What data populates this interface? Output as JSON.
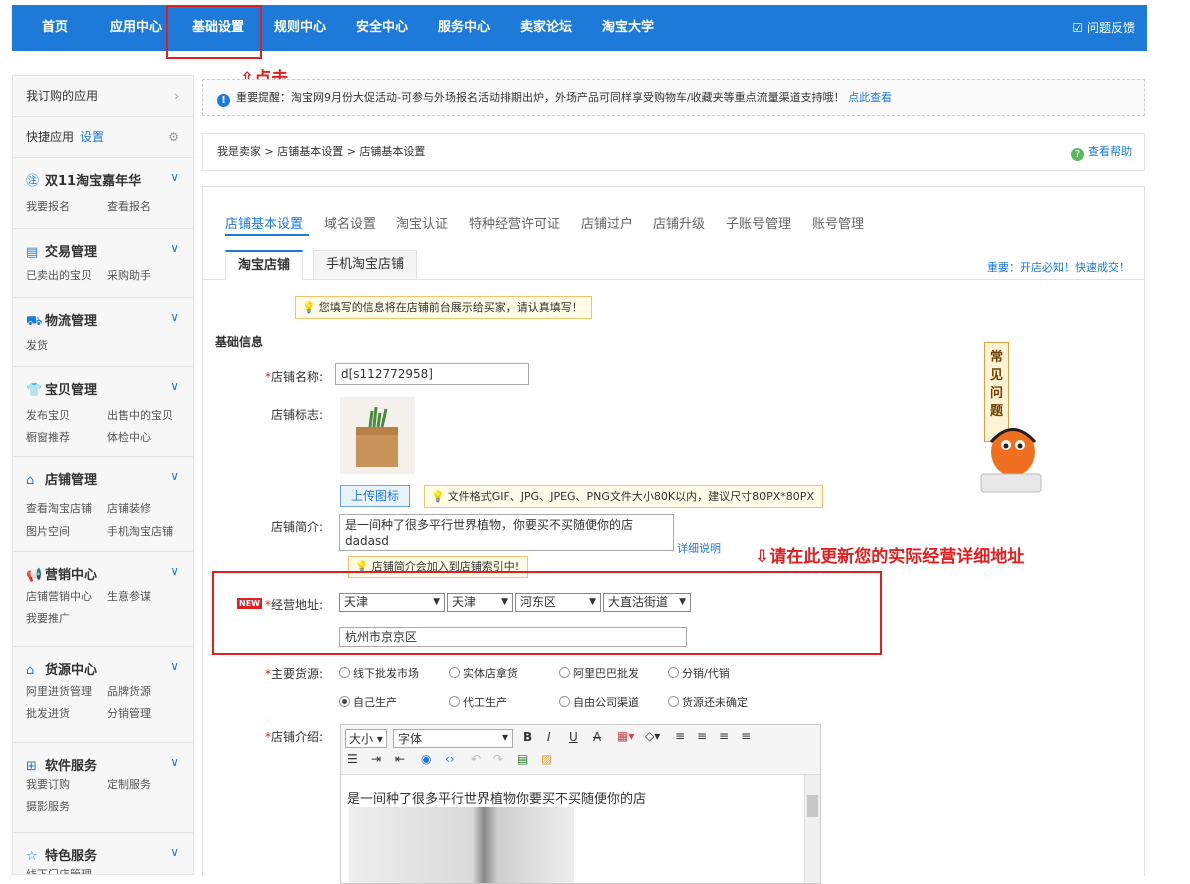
{
  "topnav": {
    "items": [
      "首页",
      "应用中心",
      "基础设置",
      "规则中心",
      "安全中心",
      "服务中心",
      "卖家论坛",
      "淘宝大学"
    ],
    "feedback": "问题反馈"
  },
  "annotations": {
    "click": "点击",
    "update_address": "请在此更新您的实际经营详细地址"
  },
  "sidebar": {
    "subscribed": "我订购的应用",
    "quick_apps": "快捷应用",
    "quick_settings": "设置",
    "sections": [
      {
        "title": "双11淘宝嘉年华",
        "icon": "double11-icon",
        "links": [
          "我要报名",
          "查看报名"
        ]
      },
      {
        "title": "交易管理",
        "icon": "document-icon",
        "links": [
          "已卖出的宝贝",
          "采购助手"
        ]
      },
      {
        "title": "物流管理",
        "icon": "truck-icon",
        "links": [
          "发货"
        ]
      },
      {
        "title": "宝贝管理",
        "icon": "shirt-icon",
        "links": [
          "发布宝贝",
          "出售中的宝贝",
          "橱窗推荐",
          "体检中心"
        ]
      },
      {
        "title": "店铺管理",
        "icon": "shop-icon",
        "links": [
          "查看淘宝店铺",
          "店铺装修",
          "图片空间",
          "手机淘宝店铺"
        ]
      },
      {
        "title": "营销中心",
        "icon": "megaphone-icon",
        "links": [
          "店铺营销中心",
          "生意参谋",
          "我要推广"
        ]
      },
      {
        "title": "货源中心",
        "icon": "house-icon",
        "links": [
          "阿里进货管理",
          "品牌货源",
          "批发进货",
          "分销管理"
        ]
      },
      {
        "title": "软件服务",
        "icon": "grid-icon",
        "links": [
          "我要订购",
          "定制服务",
          "摄影服务"
        ]
      },
      {
        "title": "特色服务",
        "icon": "star-icon",
        "links": [
          "线下门店管理"
        ]
      }
    ]
  },
  "notice": {
    "text": "重要提醒：淘宝网9月份大促活动-可参与外场报名活动排期出炉，外场产品可同样享受购物车/收藏夹等重点流量渠道支持哦！",
    "link": "点此查看"
  },
  "breadcrumb": {
    "text": "我是卖家 > 店铺基本设置 > 店铺基本设置",
    "help": "查看帮助"
  },
  "tabs": [
    "店铺基本设置",
    "域名设置",
    "淘宝认证",
    "特种经营许可证",
    "店铺过户",
    "店铺升级",
    "子账号管理",
    "账号管理"
  ],
  "subtabs": [
    "淘宝店铺",
    "手机淘宝店铺"
  ],
  "subtab_right": "重要：开店必知！快速成交！",
  "form": {
    "tip_info": "您填写的信息将在店铺前台展示给买家，请认真填写！",
    "section_title": "基础信息",
    "shop_name_label": "店铺名称:",
    "shop_name_value": "d[s112772958]",
    "logo_label": "店铺标志:",
    "upload_button": "上传图标",
    "upload_tip": "文件格式GIF、JPG、JPEG、PNG文件大小80K以内，建议尺寸80PX*80PX",
    "intro_label": "店铺简介:",
    "intro_value": "是一间种了很多平行世界植物，你要买不买随便你的店 dadasd",
    "intro_detail_link": "详细说明",
    "intro_tip": "店铺简介会加入到店铺索引中!",
    "new_badge": "NEW",
    "address_label": "经营地址:",
    "address_selects": [
      "天津",
      "天津",
      "河东区",
      "大直沽街道"
    ],
    "address_detail": "杭州市京京区",
    "source_label": "主要货源:",
    "sources": [
      {
        "label": "线下批发市场",
        "checked": false
      },
      {
        "label": "实体店拿货",
        "checked": false
      },
      {
        "label": "阿里巴巴批发",
        "checked": false
      },
      {
        "label": "分销/代销",
        "checked": false
      },
      {
        "label": "自己生产",
        "checked": true
      },
      {
        "label": "代工生产",
        "checked": false
      },
      {
        "label": "自由公司渠道",
        "checked": false
      },
      {
        "label": "货源还未确定",
        "checked": false
      }
    ],
    "desc_label": "店铺介绍:",
    "editor_size": "大小",
    "editor_font": "字体",
    "editor_text": "是一间种了很多平行世界植物你要买不买随便你的店"
  },
  "faq": "常见问题",
  "required_mark": "*"
}
